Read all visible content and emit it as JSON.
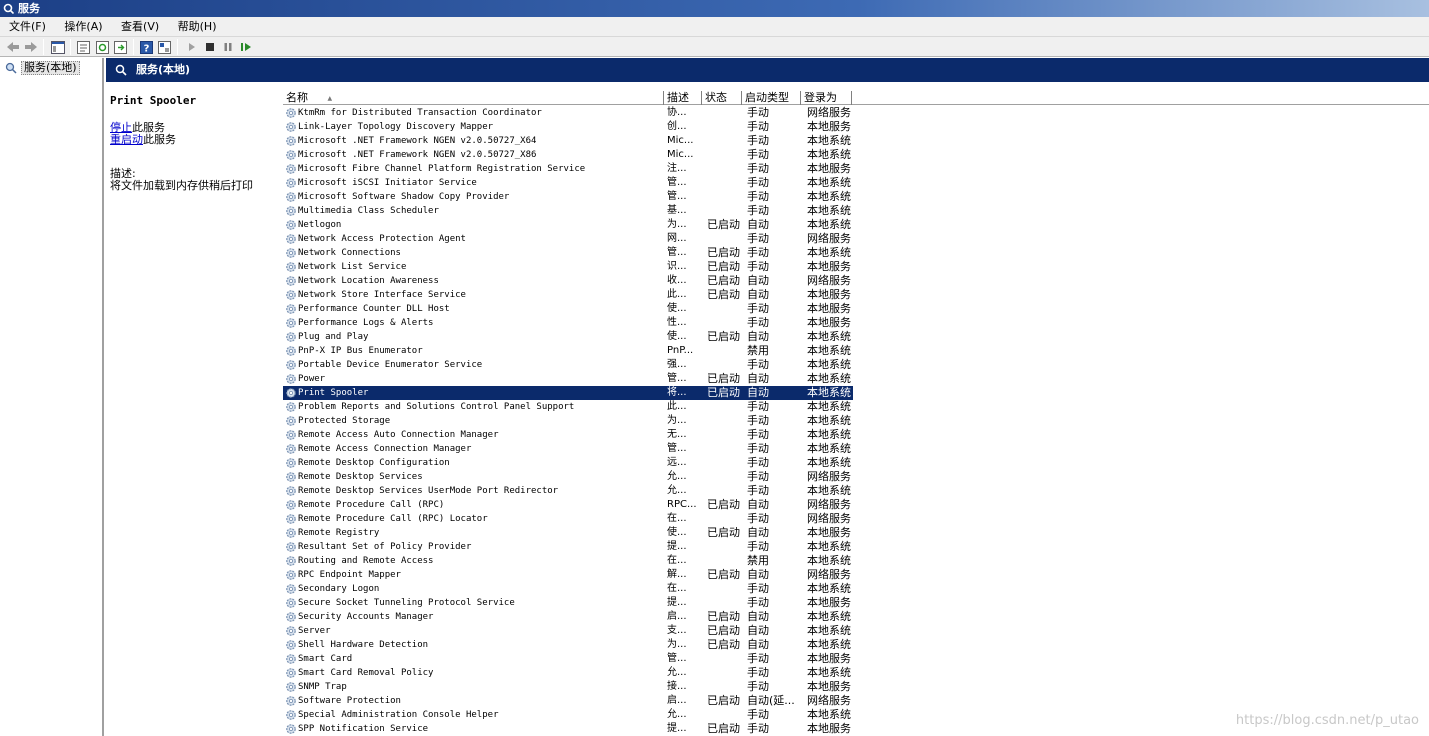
{
  "window": {
    "title": "服务"
  },
  "menu": [
    "文件(F)",
    "操作(A)",
    "查看(V)",
    "帮助(H)"
  ],
  "tree": {
    "item": "服务(本地)"
  },
  "panel": {
    "header": "服务(本地)",
    "selected_service": "Print Spooler",
    "stop_link": "停止",
    "stop_suffix": "此服务",
    "restart_link": "重启动",
    "restart_suffix": "此服务",
    "desc_label": "描述:",
    "desc_text": "将文件加载到内存供稍后打印"
  },
  "columns": [
    "名称",
    "描述",
    "状态",
    "启动类型",
    "登录为"
  ],
  "sort_indicator": "▲",
  "rows": [
    {
      "name": "KtmRm for Distributed Transaction Coordinator",
      "desc": "协...",
      "status": "",
      "start": "手动",
      "logon": "网络服务"
    },
    {
      "name": "Link-Layer Topology Discovery Mapper",
      "desc": "创...",
      "status": "",
      "start": "手动",
      "logon": "本地服务"
    },
    {
      "name": "Microsoft .NET Framework NGEN v2.0.50727_X64",
      "desc": "Mic...",
      "status": "",
      "start": "手动",
      "logon": "本地系统"
    },
    {
      "name": "Microsoft .NET Framework NGEN v2.0.50727_X86",
      "desc": "Mic...",
      "status": "",
      "start": "手动",
      "logon": "本地系统"
    },
    {
      "name": "Microsoft Fibre Channel Platform Registration Service",
      "desc": "注...",
      "status": "",
      "start": "手动",
      "logon": "本地服务"
    },
    {
      "name": "Microsoft iSCSI Initiator Service",
      "desc": "管...",
      "status": "",
      "start": "手动",
      "logon": "本地系统"
    },
    {
      "name": "Microsoft Software Shadow Copy Provider",
      "desc": "管...",
      "status": "",
      "start": "手动",
      "logon": "本地系统"
    },
    {
      "name": "Multimedia Class Scheduler",
      "desc": "基...",
      "status": "",
      "start": "手动",
      "logon": "本地系统"
    },
    {
      "name": "Netlogon",
      "desc": "为...",
      "status": "已启动",
      "start": "自动",
      "logon": "本地系统"
    },
    {
      "name": "Network Access Protection Agent",
      "desc": "网...",
      "status": "",
      "start": "手动",
      "logon": "网络服务"
    },
    {
      "name": "Network Connections",
      "desc": "管...",
      "status": "已启动",
      "start": "手动",
      "logon": "本地系统"
    },
    {
      "name": "Network List Service",
      "desc": "识...",
      "status": "已启动",
      "start": "手动",
      "logon": "本地服务"
    },
    {
      "name": "Network Location Awareness",
      "desc": "收...",
      "status": "已启动",
      "start": "自动",
      "logon": "网络服务"
    },
    {
      "name": "Network Store Interface Service",
      "desc": "此...",
      "status": "已启动",
      "start": "自动",
      "logon": "本地服务"
    },
    {
      "name": "Performance Counter DLL Host",
      "desc": "使...",
      "status": "",
      "start": "手动",
      "logon": "本地服务"
    },
    {
      "name": "Performance Logs & Alerts",
      "desc": "性...",
      "status": "",
      "start": "手动",
      "logon": "本地服务"
    },
    {
      "name": "Plug and Play",
      "desc": "使...",
      "status": "已启动",
      "start": "自动",
      "logon": "本地系统"
    },
    {
      "name": "PnP-X IP Bus Enumerator",
      "desc": "PnP...",
      "status": "",
      "start": "禁用",
      "logon": "本地系统"
    },
    {
      "name": "Portable Device Enumerator Service",
      "desc": "强...",
      "status": "",
      "start": "手动",
      "logon": "本地系统"
    },
    {
      "name": "Power",
      "desc": "管...",
      "status": "已启动",
      "start": "自动",
      "logon": "本地系统"
    },
    {
      "name": "Print Spooler",
      "desc": "将...",
      "status": "已启动",
      "start": "自动",
      "logon": "本地系统",
      "selected": true
    },
    {
      "name": "Problem Reports and Solutions Control Panel Support",
      "desc": "此...",
      "status": "",
      "start": "手动",
      "logon": "本地系统"
    },
    {
      "name": "Protected Storage",
      "desc": "为...",
      "status": "",
      "start": "手动",
      "logon": "本地系统"
    },
    {
      "name": "Remote Access Auto Connection Manager",
      "desc": "无...",
      "status": "",
      "start": "手动",
      "logon": "本地系统"
    },
    {
      "name": "Remote Access Connection Manager",
      "desc": "管...",
      "status": "",
      "start": "手动",
      "logon": "本地系统"
    },
    {
      "name": "Remote Desktop Configuration",
      "desc": "远...",
      "status": "",
      "start": "手动",
      "logon": "本地系统"
    },
    {
      "name": "Remote Desktop Services",
      "desc": "允...",
      "status": "",
      "start": "手动",
      "logon": "网络服务"
    },
    {
      "name": "Remote Desktop Services UserMode Port Redirector",
      "desc": "允...",
      "status": "",
      "start": "手动",
      "logon": "本地系统"
    },
    {
      "name": "Remote Procedure Call (RPC)",
      "desc": "RPC...",
      "status": "已启动",
      "start": "自动",
      "logon": "网络服务"
    },
    {
      "name": "Remote Procedure Call (RPC) Locator",
      "desc": "在...",
      "status": "",
      "start": "手动",
      "logon": "网络服务"
    },
    {
      "name": "Remote Registry",
      "desc": "使...",
      "status": "已启动",
      "start": "自动",
      "logon": "本地服务"
    },
    {
      "name": "Resultant Set of Policy Provider",
      "desc": "提...",
      "status": "",
      "start": "手动",
      "logon": "本地系统"
    },
    {
      "name": "Routing and Remote Access",
      "desc": "在...",
      "status": "",
      "start": "禁用",
      "logon": "本地系统"
    },
    {
      "name": "RPC Endpoint Mapper",
      "desc": "解...",
      "status": "已启动",
      "start": "自动",
      "logon": "网络服务"
    },
    {
      "name": "Secondary Logon",
      "desc": "在...",
      "status": "",
      "start": "手动",
      "logon": "本地系统"
    },
    {
      "name": "Secure Socket Tunneling Protocol Service",
      "desc": "提...",
      "status": "",
      "start": "手动",
      "logon": "本地服务"
    },
    {
      "name": "Security Accounts Manager",
      "desc": "启...",
      "status": "已启动",
      "start": "自动",
      "logon": "本地系统"
    },
    {
      "name": "Server",
      "desc": "支...",
      "status": "已启动",
      "start": "自动",
      "logon": "本地系统"
    },
    {
      "name": "Shell Hardware Detection",
      "desc": "为...",
      "status": "已启动",
      "start": "自动",
      "logon": "本地系统"
    },
    {
      "name": "Smart Card",
      "desc": "管...",
      "status": "",
      "start": "手动",
      "logon": "本地服务"
    },
    {
      "name": "Smart Card Removal Policy",
      "desc": "允...",
      "status": "",
      "start": "手动",
      "logon": "本地系统"
    },
    {
      "name": "SNMP Trap",
      "desc": "接...",
      "status": "",
      "start": "手动",
      "logon": "本地服务"
    },
    {
      "name": "Software Protection",
      "desc": "启...",
      "status": "已启动",
      "start": "自动(延...",
      "logon": "网络服务"
    },
    {
      "name": "Special Administration Console Helper",
      "desc": "允...",
      "status": "",
      "start": "手动",
      "logon": "本地系统"
    },
    {
      "name": "SPP Notification Service",
      "desc": "提...",
      "status": "已启动",
      "start": "手动",
      "logon": "本地服务"
    }
  ],
  "watermark": "https://blog.csdn.net/p_utao",
  "colors": {
    "header_bg": "#0b2a6b",
    "selection_bg": "#0b2a6b",
    "link": "#0000cc"
  }
}
